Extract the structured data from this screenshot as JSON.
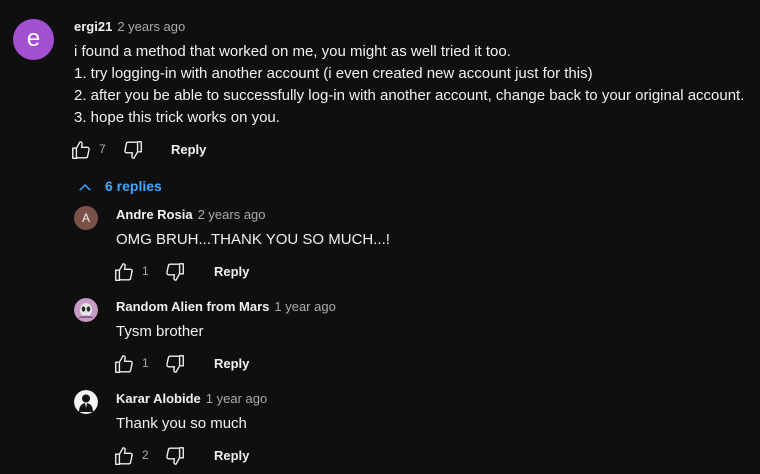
{
  "comment": {
    "avatar_letter": "e",
    "author": "ergi21",
    "time": "2 years ago",
    "lines": [
      "i found a method that worked on me, you might as well tried it too.",
      "1. try logging-in with another account (i even created new account just for this)",
      "2. after you be able to successfully log-in with another account, change back to your original account.",
      "3. hope this trick works on you."
    ],
    "likes": "7",
    "reply_label": "Reply"
  },
  "replies_toggle": {
    "label": "6 replies"
  },
  "replies": [
    {
      "avatar_letter": "A",
      "author": "Andre Rosia",
      "time": "2 years ago",
      "text": "OMG BRUH...THANK YOU SO MUCH...!",
      "likes": "1",
      "reply_label": "Reply"
    },
    {
      "author": "Random Alien from Mars",
      "time": "1 year ago",
      "text": "Tysm brother",
      "likes": "1",
      "reply_label": "Reply"
    },
    {
      "author": "Karar Alobide",
      "time": "1 year ago",
      "text": "Thank you so much",
      "likes": "2",
      "reply_label": "Reply"
    }
  ],
  "colors": {
    "background": "#0f0f0f",
    "main_avatar": "#a34fd1",
    "link_blue": "#3ea6ff",
    "secondary_text": "#aaaaaa"
  }
}
